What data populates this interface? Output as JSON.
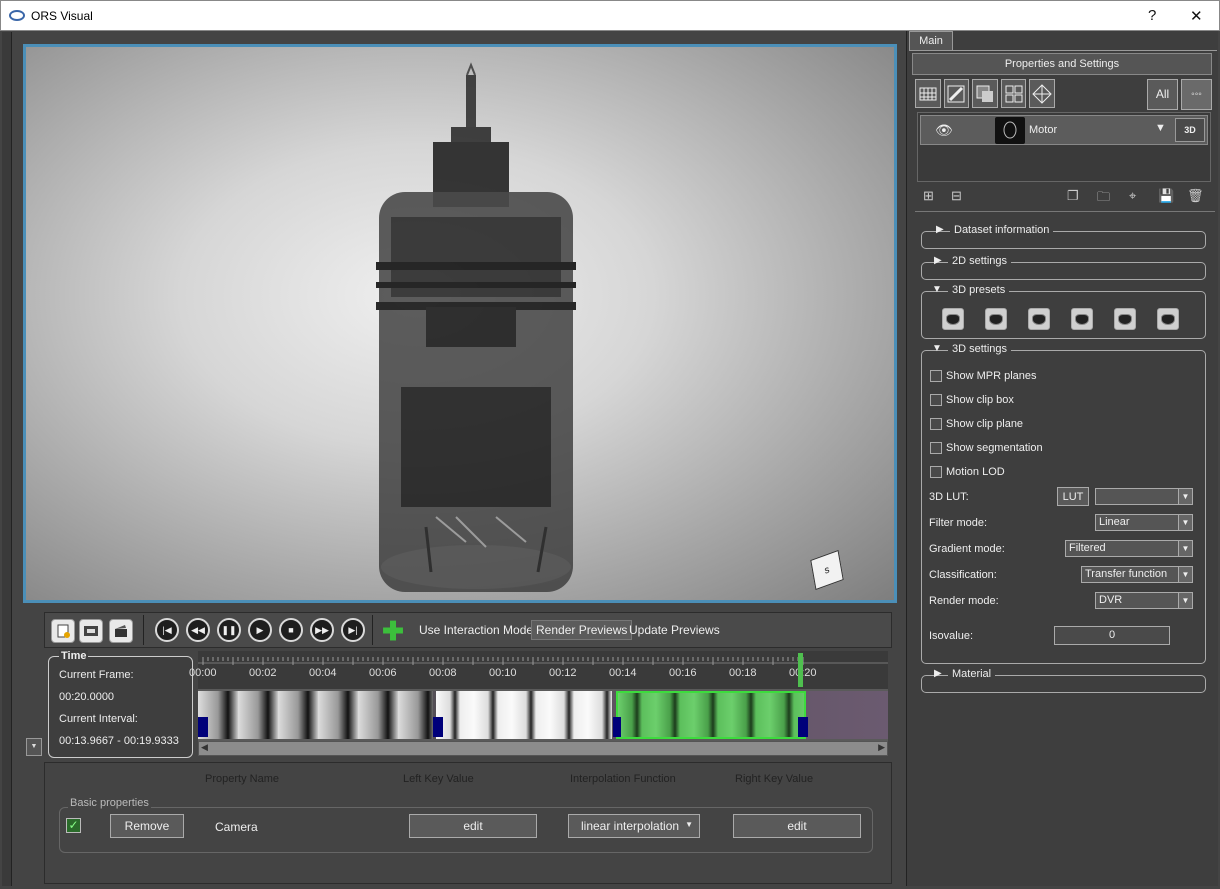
{
  "window": {
    "title": "ORS Visual",
    "help_glyph": "?",
    "close_glyph": "✕"
  },
  "viewport": {
    "orientation_cube_label": "s"
  },
  "toolbar": {
    "mode_links": [
      "Use Interaction Mode",
      "Render Previews",
      "Update Previews"
    ],
    "active_mode": "Render Previews"
  },
  "time": {
    "title": "Time",
    "current_frame_label": "Current Frame:",
    "current_frame_value": "00:20.0000",
    "current_interval_label": "Current Interval:",
    "current_interval_value": "00:13.9667 - 00:19.9333"
  },
  "timeline": {
    "ticks": [
      "00:00",
      "00:02",
      "00:04",
      "00:06",
      "00:08",
      "00:10",
      "00:12",
      "00:14",
      "00:16",
      "00:18",
      "00:20"
    ],
    "current_time": "00:20.0000",
    "colors": {
      "selection": "#4fbf4f",
      "marker": "#00007a"
    }
  },
  "properties": {
    "headers": [
      "Property Name",
      "Left Key Value",
      "Interpolation Function",
      "Right Key Value"
    ],
    "group": "Basic properties",
    "row": {
      "checked": true,
      "remove_label": "Remove",
      "name": "Camera",
      "left_edit": "edit",
      "interpolation": "linear interpolation",
      "right_edit": "edit"
    }
  },
  "right_panel": {
    "tab": "Main",
    "title": "Properties and Settings",
    "filter_all": "All",
    "layer": {
      "name": "Motor",
      "badge": "3D"
    },
    "sections": {
      "dataset": "Dataset information",
      "settings2d": "2D settings",
      "presets3d": "3D presets",
      "settings3d": "3D settings",
      "material": "Material"
    },
    "checkboxes": [
      "Show MPR planes",
      "Show clip box",
      "Show clip plane",
      "Show segmentation",
      "Motion LOD"
    ],
    "lut": {
      "label": "3D LUT:",
      "button": "LUT",
      "value": ""
    },
    "filter_mode": {
      "label": "Filter mode:",
      "value": "Linear"
    },
    "gradient_mode": {
      "label": "Gradient mode:",
      "value": "Filtered"
    },
    "classification": {
      "label": "Classification:",
      "value": "Transfer function"
    },
    "render_mode": {
      "label": "Render mode:",
      "value": "DVR"
    },
    "isovalue": {
      "label": "Isovalue:",
      "value": "0"
    }
  }
}
